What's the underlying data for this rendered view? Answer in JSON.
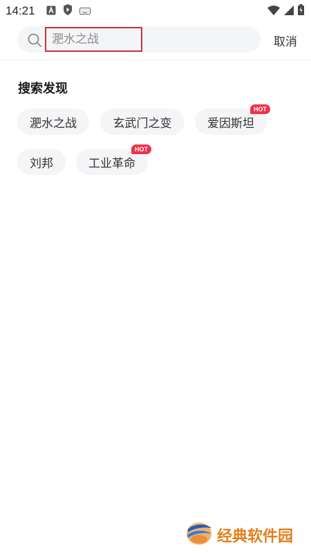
{
  "status_bar": {
    "time": "14:21",
    "left_icons": [
      "a-app-icon",
      "play-shield-icon",
      "keyboard-icon"
    ],
    "right_icons": [
      "wifi-icon",
      "signal-icon",
      "battery-icon"
    ]
  },
  "search": {
    "placeholder": "淝水之战",
    "value": "",
    "cancel_label": "取消"
  },
  "discover": {
    "title": "搜索发现",
    "chips": [
      {
        "label": "淝水之战",
        "hot": false
      },
      {
        "label": "玄武门之变",
        "hot": false
      },
      {
        "label": "爱因斯坦",
        "hot": true
      },
      {
        "label": "刘邦",
        "hot": false
      },
      {
        "label": "工业革命",
        "hot": true
      }
    ],
    "hot_badge_label": "HOT"
  },
  "watermark": {
    "text": "经典软件园"
  },
  "colors": {
    "accent_red": "#f0324a",
    "focus_border": "#c8323a",
    "chip_bg": "#f4f5f7",
    "watermark_orange": "#e27f1c"
  }
}
